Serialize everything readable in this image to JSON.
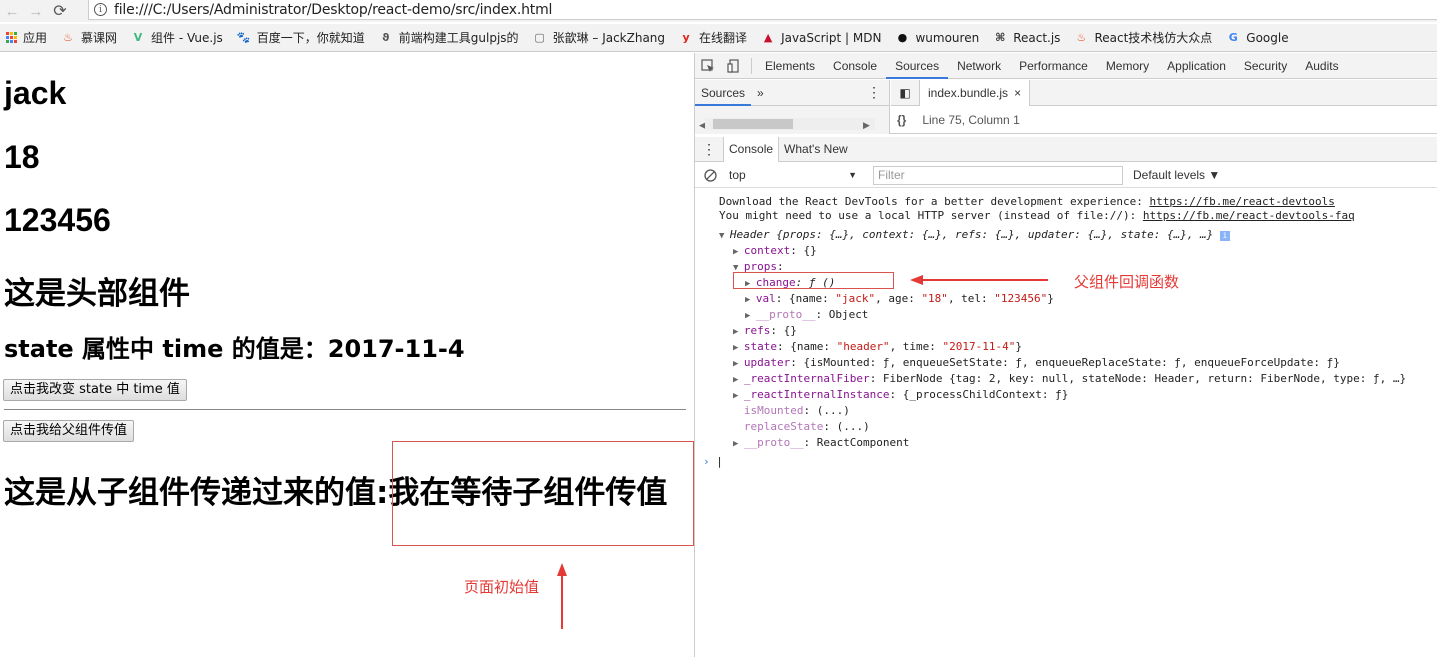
{
  "browser": {
    "url": "file:///C:/Users/Administrator/Desktop/react-demo/src/index.html",
    "back_glyph": "←",
    "forward_glyph": "→",
    "reload_glyph": "⟳",
    "info_glyph": "i",
    "bookmarks": [
      {
        "label": "应用",
        "icon": "apps-grid-icon"
      },
      {
        "label": "慕课网",
        "icon": "flame-icon",
        "glyph": "♨",
        "color": "#e84a1b"
      },
      {
        "label": "组件 - Vue.js",
        "icon": "vue-icon",
        "glyph": "V",
        "color": "#41b883"
      },
      {
        "label": "百度一下，你就知道",
        "icon": "paw-icon",
        "glyph": "🐾",
        "color": "#2932e1"
      },
      {
        "label": "前端构建工具gulpjs的",
        "icon": "gulp-icon",
        "glyph": "ϑ",
        "color": "#555555"
      },
      {
        "label": "张歆琳 – JackZhang",
        "icon": "page-icon",
        "glyph": "▢",
        "color": "#666666"
      },
      {
        "label": "在线翻译",
        "icon": "youdao-icon",
        "glyph": "y",
        "color": "#e0271b"
      },
      {
        "label": "JavaScript | MDN",
        "icon": "mdn-icon",
        "glyph": "▲",
        "color": "#c8102e"
      },
      {
        "label": "wumouren",
        "icon": "github-icon",
        "glyph": "●",
        "color": "#111111"
      },
      {
        "label": "React.js",
        "icon": "command-icon",
        "glyph": "⌘",
        "color": "#333333"
      },
      {
        "label": "React技术栈仿大众点",
        "icon": "flame-icon",
        "glyph": "♨",
        "color": "#e84a1b"
      },
      {
        "label": "Google",
        "icon": "google-icon",
        "glyph": "G",
        "color": "#4285f4"
      }
    ]
  },
  "page": {
    "name": "jack",
    "age": "18",
    "tel": "123456",
    "header_title": "这是头部组件",
    "state_line": "state 属性中 time 的值是：2017-11-4",
    "btn_change_time": "点击我改变 state 中 time 值",
    "btn_to_parent": "点击我给父组件传值",
    "child_value_label": "这是从子组件传递过来的值:",
    "child_value": "我在等待子组件传值",
    "annotation_initial": "页面初始值",
    "annotation_callback": "父组件回调函数",
    "annotation_color": "#e53935"
  },
  "devtools": {
    "tabs": [
      "Elements",
      "Console",
      "Sources",
      "Network",
      "Performance",
      "Memory",
      "Application",
      "Security",
      "Audits"
    ],
    "active_tab": "Sources",
    "navigator_label": "Sources",
    "more_glyph": "»",
    "file_tab": "index.bundle.js",
    "status": "Line 75, Column 1",
    "format_glyph": "{}",
    "drawer_tabs": [
      "Console",
      "What's New"
    ],
    "context": "top",
    "filter_placeholder": "Filter",
    "levels": "Default levels ▼",
    "accent": "#3879d9",
    "console": {
      "msg1_text": "Download the React DevTools for a better development experience: ",
      "msg1_link": "https://fb.me/react-devtools",
      "msg2_text": "You might need to use a local HTTP server (instead of file://): ",
      "msg2_link": "https://fb.me/react-devtools-faq",
      "obj_name": "Header",
      "obj_summary": " {props: {…}, context: {…}, refs: {…}, updater: {…}, state: {…}, …}",
      "rows": {
        "context": [
          "context",
          ": {}"
        ],
        "props": [
          "props",
          ":"
        ],
        "change": [
          "change",
          ": ƒ ()"
        ],
        "val": [
          "val",
          ": {name: ",
          "\"jack\"",
          ", age: ",
          "\"18\"",
          ", tel: ",
          "\"123456\"",
          "}"
        ],
        "proto1": [
          "__proto__",
          ": Object"
        ],
        "refs": [
          "refs",
          ": {}"
        ],
        "state": [
          "state",
          ": {name: ",
          "\"header\"",
          ", time: ",
          "\"2017-11-4\"",
          "}"
        ],
        "updater": [
          "updater",
          ": {isMounted: ƒ, enqueueSetState: ƒ, enqueueReplaceState: ƒ, enqueueForceUpdate: ƒ}"
        ],
        "fiber": [
          "_reactInternalFiber",
          ": FiberNode {tag: 2, key: null, stateNode: Header, return: FiberNode, type: ƒ, …}"
        ],
        "instance": [
          "_reactInternalInstance",
          ": {_processChildContext: ƒ}"
        ],
        "isMounted": [
          "isMounted",
          ": (...)"
        ],
        "replaceState": [
          "replaceState",
          ": (...)"
        ],
        "proto2": [
          "__proto__",
          ": ReactComponent"
        ]
      }
    }
  }
}
